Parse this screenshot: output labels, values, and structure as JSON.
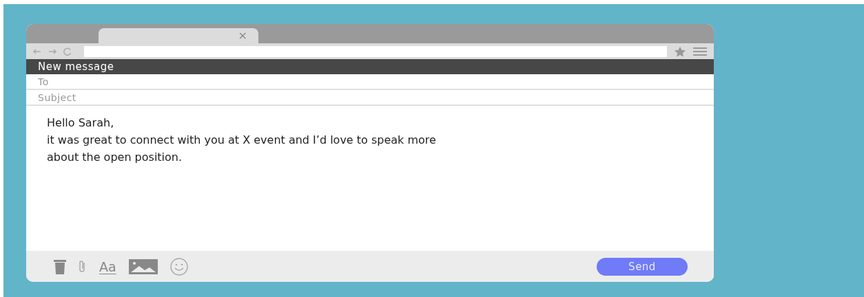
{
  "browser": {
    "tab": {
      "close": "×"
    }
  },
  "compose": {
    "title": "New message",
    "to": {
      "placeholder": "To"
    },
    "subject": {
      "placeholder": "Subject"
    },
    "body": [
      "Hello Sarah,",
      "it was great to connect with you at X event and I’d love to speak more",
      "about the open position."
    ],
    "toolbar": {
      "format": "Aa",
      "send": "Send"
    }
  }
}
